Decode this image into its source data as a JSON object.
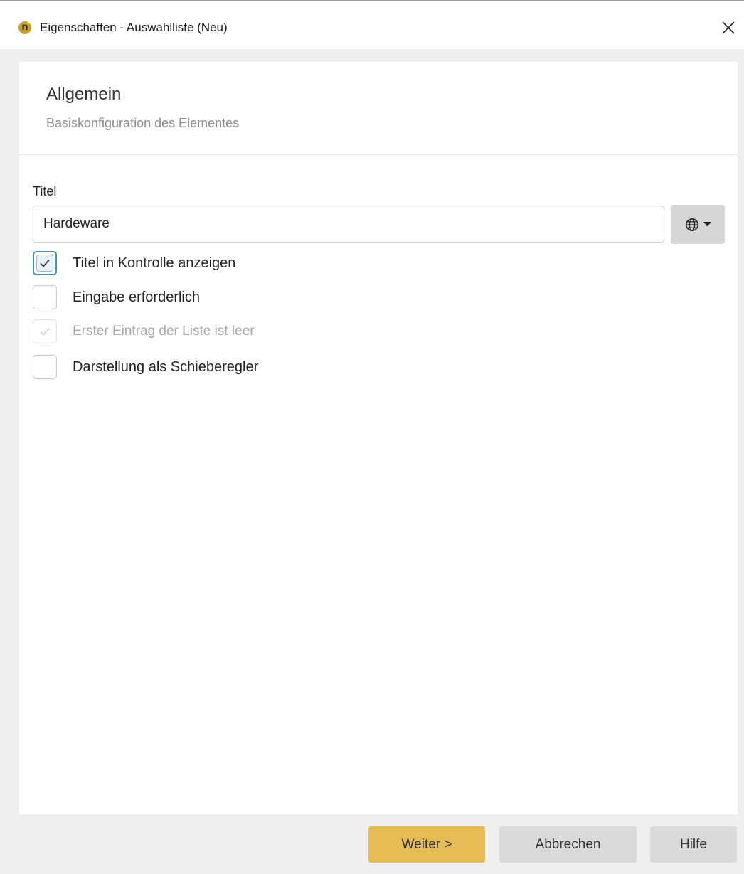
{
  "window": {
    "title": "Eigenschaften - Auswahlliste (Neu)",
    "app_icon_glyph": "n",
    "accent_color": "#c9a227"
  },
  "header": {
    "title": "Allgemein",
    "subtitle": "Basiskonfiguration des Elementes"
  },
  "form": {
    "title_label": "Titel",
    "title_value": "Hardeware",
    "language_button_icon": "globe-icon"
  },
  "options": [
    {
      "label": "Titel in Kontrolle anzeigen",
      "checked": true,
      "disabled": false
    },
    {
      "label": "Eingabe erforderlich",
      "checked": false,
      "disabled": false
    },
    {
      "label": "Erster Eintrag der Liste ist leer",
      "checked": true,
      "disabled": true
    },
    {
      "label": "Darstellung als Schieberegler",
      "checked": false,
      "disabled": false
    }
  ],
  "footer": {
    "next_label": "Weiter >",
    "cancel_label": "Abbrechen",
    "help_label": "Hilfe",
    "primary_color": "#e6bd55"
  }
}
